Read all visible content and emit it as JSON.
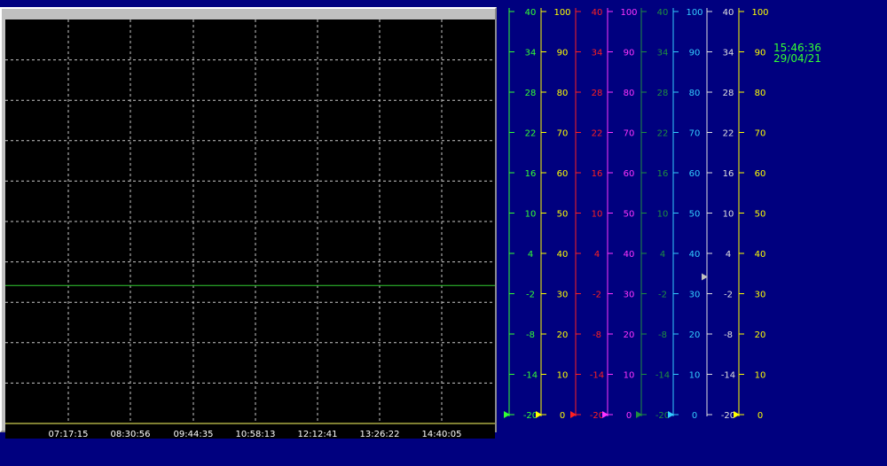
{
  "clock": {
    "time": "15:46:36",
    "date": "29/04/21"
  },
  "chart_data": {
    "type": "line",
    "x": [
      "07:17:15",
      "08:30:56",
      "09:44:35",
      "10:58:13",
      "12:12:41",
      "13:26:22",
      "14:40:05"
    ],
    "grid": true,
    "series": [
      {
        "values": [
          0.5,
          0.5,
          0.5,
          0.5,
          0.5,
          0.5,
          0.5
        ],
        "color": "#33cc33",
        "scale_index": 0
      }
    ],
    "scales": [
      {
        "range": [
          -20,
          40
        ],
        "ticks": [
          "40",
          "34",
          "28",
          "22",
          "16",
          "10",
          "4",
          "-2",
          "-8",
          "-14",
          "-20"
        ],
        "color": "#33ff33",
        "marker": "#33ff33"
      },
      {
        "range": [
          0,
          100
        ],
        "ticks": [
          "100",
          "90",
          "80",
          "70",
          "60",
          "50",
          "40",
          "30",
          "20",
          "10",
          "0"
        ],
        "color": "#ffff00",
        "marker": "#ffff00"
      },
      {
        "range": [
          -20,
          40
        ],
        "ticks": [
          "40",
          "34",
          "28",
          "22",
          "16",
          "10",
          "4",
          "-2",
          "-8",
          "-14",
          "-20"
        ],
        "color": "#ff2020",
        "marker": "#ff2020"
      },
      {
        "range": [
          0,
          100
        ],
        "ticks": [
          "100",
          "90",
          "80",
          "70",
          "60",
          "50",
          "40",
          "30",
          "20",
          "10",
          "0"
        ],
        "color": "#ff33ff",
        "marker": "#ff33ff"
      },
      {
        "range": [
          -20,
          40
        ],
        "ticks": [
          "40",
          "34",
          "28",
          "22",
          "16",
          "10",
          "4",
          "-2",
          "-8",
          "-14",
          "-20"
        ],
        "color": "#1f8f3f",
        "marker": "#1f8f3f"
      },
      {
        "range": [
          0,
          100
        ],
        "ticks": [
          "100",
          "90",
          "80",
          "70",
          "60",
          "50",
          "40",
          "30",
          "20",
          "10",
          "0"
        ],
        "color": "#33ccff",
        "marker": "#33ccff"
      },
      {
        "range": [
          -20,
          40
        ],
        "ticks": [
          "40",
          "34",
          "28",
          "22",
          "16",
          "10",
          "4",
          "-2",
          "-8",
          "-14",
          "-20"
        ],
        "color": "#e0e0e0",
        "marker": "#c0c0c0",
        "marker_value": 0.5
      },
      {
        "range": [
          0,
          100
        ],
        "ticks": [
          "100",
          "90",
          "80",
          "70",
          "60",
          "50",
          "40",
          "30",
          "20",
          "10",
          "0"
        ],
        "color": "#ffff00",
        "marker": "#ffff00"
      }
    ]
  }
}
